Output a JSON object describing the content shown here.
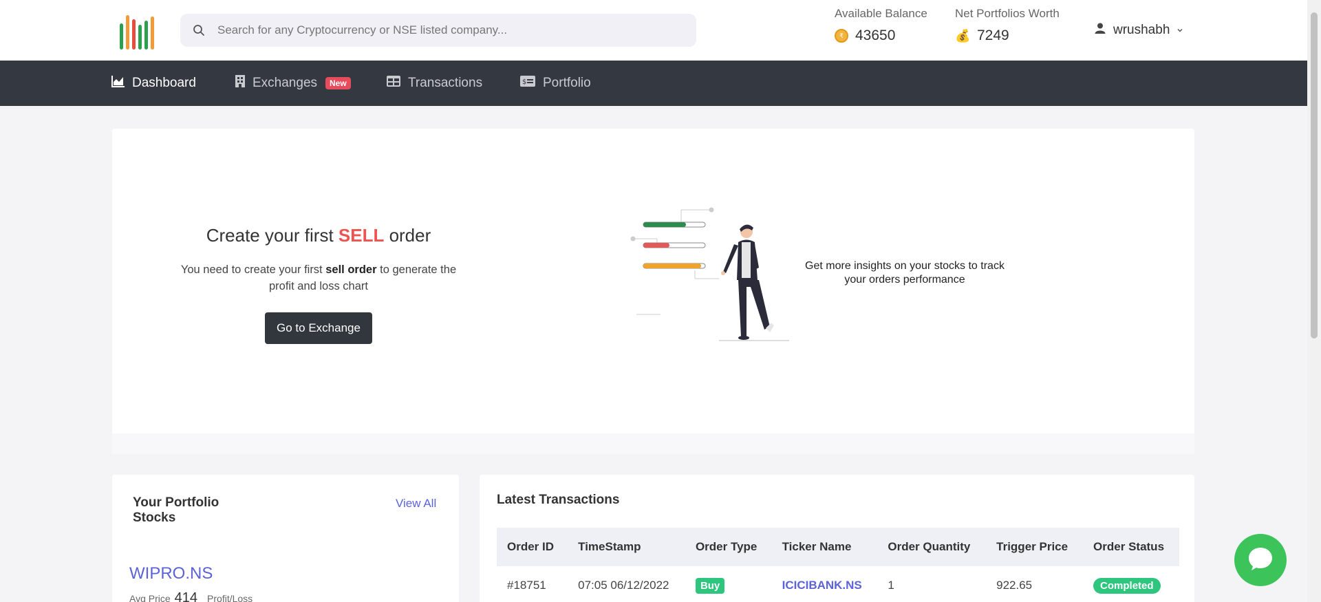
{
  "header": {
    "search_placeholder": "Search for any Cryptocurrency or NSE listed company...",
    "available_balance_label": "Available Balance",
    "available_balance_value": "43650",
    "net_worth_label": "Net Portfolios Worth",
    "net_worth_value": "7249",
    "username": "wrushabh"
  },
  "nav": {
    "items": [
      {
        "label": "Dashboard",
        "active": true
      },
      {
        "label": "Exchanges",
        "badge": "New"
      },
      {
        "label": "Transactions"
      },
      {
        "label": "Portfolio"
      }
    ]
  },
  "hero": {
    "title_prefix": "Create your first ",
    "title_highlight": "SELL",
    "title_suffix": " order",
    "desc_prefix": "You need to create your first ",
    "desc_bold": "sell order",
    "desc_suffix": " to generate the profit and loss chart",
    "button_label": "Go to Exchange",
    "insight_text": "Get more insights on your stocks to track your orders performance"
  },
  "portfolio": {
    "title": "Your Portfolio Stocks",
    "view_all": "View All",
    "stock_name": "WIPRO.NS",
    "avg_label": "Avg Price",
    "avg_value": "414",
    "profit_label": "Profit/Loss"
  },
  "transactions": {
    "title": "Latest Transactions",
    "columns": [
      "Order ID",
      "TimeStamp",
      "Order Type",
      "Ticker Name",
      "Order Quantity",
      "Trigger Price",
      "Order Status"
    ],
    "rows": [
      {
        "order_id": "#18751",
        "timestamp": "07:05 06/12/2022",
        "type": "Buy",
        "ticker": "ICICIBANK.NS",
        "quantity": "1",
        "price": "922.65",
        "status": "Completed"
      }
    ]
  },
  "colors": {
    "nav_bg": "#343840",
    "accent_blue": "#5a63d8",
    "sell_red": "#ef5350",
    "success_green": "#2ec57f",
    "chat_green": "#3cc45a"
  },
  "icons": [
    "search-icon",
    "coin-icon",
    "money-bag-icon",
    "user-icon",
    "chevron-down-icon",
    "chart-icon",
    "building-icon",
    "table-icon",
    "wallet-icon",
    "chat-icon"
  ]
}
